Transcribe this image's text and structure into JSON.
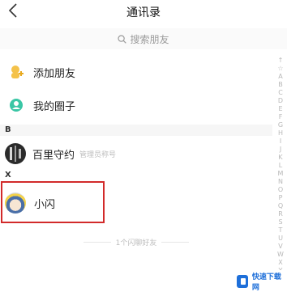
{
  "header": {
    "title": "通讯录",
    "back_icon": "chevron-left-icon"
  },
  "search": {
    "placeholder": "搜索朋友",
    "icon": "search-icon"
  },
  "menu": [
    {
      "label": "添加朋友",
      "icon": "add-friend-icon",
      "color": "#f4c24a"
    },
    {
      "label": "我的圈子",
      "icon": "circle-icon",
      "color": "#39c6a5"
    }
  ],
  "sections": [
    {
      "letter": "B",
      "contacts": [
        {
          "name": "百里守约",
          "subtitle": "管理员称号",
          "avatar": "dark-avatar"
        }
      ]
    },
    {
      "letter": "X",
      "contacts": [
        {
          "name": "小闪",
          "subtitle": "",
          "avatar": "anime-avatar"
        }
      ]
    }
  ],
  "footer": {
    "count_text": "1个闪聊好友"
  },
  "index_bar": [
    "↑",
    "☆",
    "A",
    "B",
    "C",
    "D",
    "E",
    "F",
    "G",
    "H",
    "I",
    "J",
    "K",
    "L",
    "M",
    "N",
    "O",
    "P",
    "Q",
    "R",
    "S",
    "T",
    "U",
    "V",
    "W",
    "X",
    "Y",
    "Z",
    "#"
  ],
  "watermark": {
    "text": "快速下载网"
  },
  "colors": {
    "highlight": "#d22a2a",
    "accent": "#1e6fd9"
  }
}
